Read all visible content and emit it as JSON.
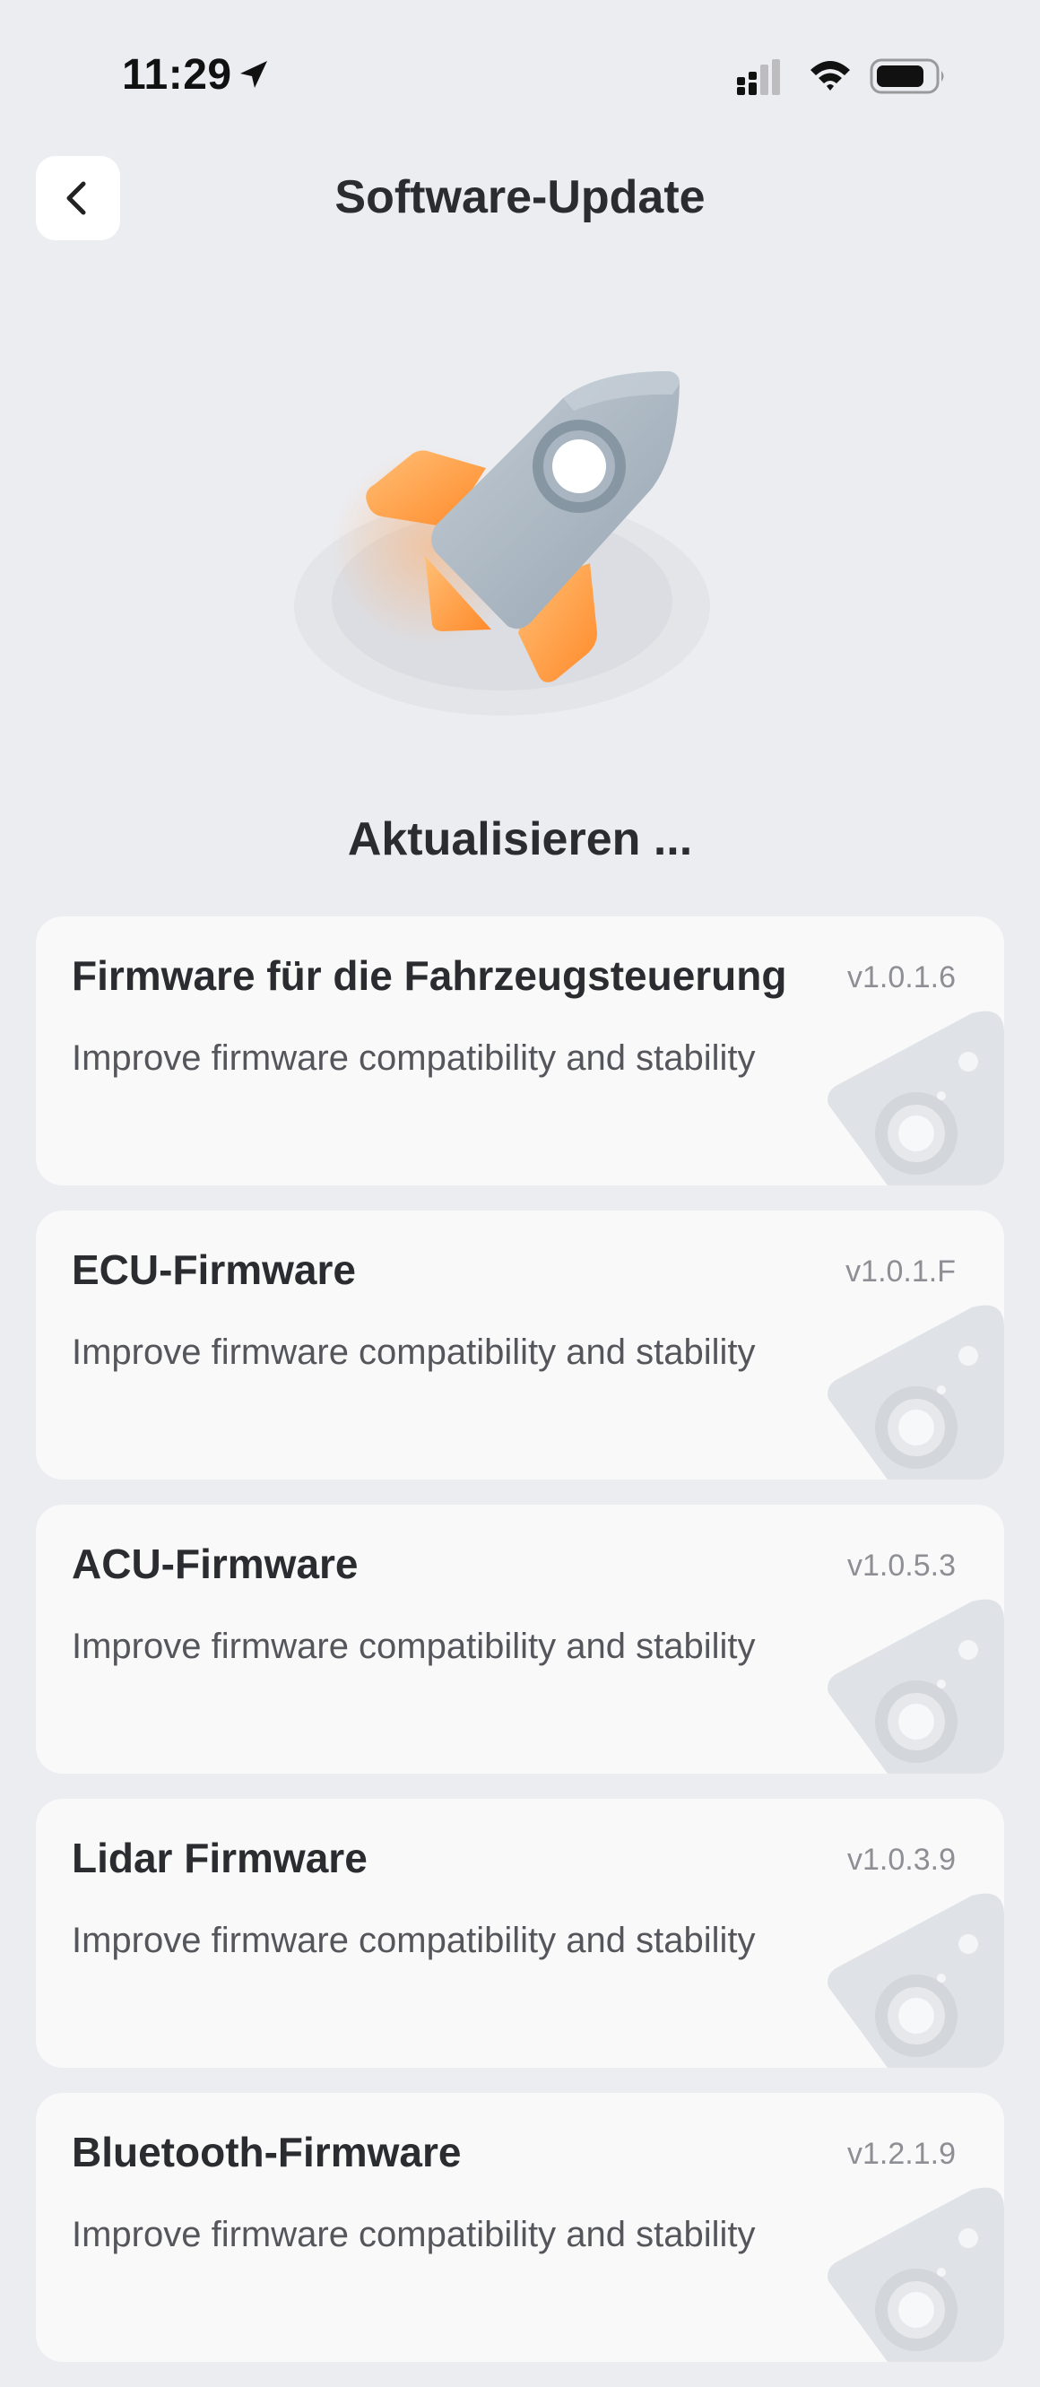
{
  "status_bar": {
    "time": "11:29"
  },
  "header": {
    "title": "Software-Update"
  },
  "hero": {
    "status_text": "Aktualisieren ..."
  },
  "firmware_items": [
    {
      "name": "Firmware für die Fahrzeugsteuerung",
      "version": "v1.0.1.6",
      "description": "Improve firmware compatibility and stability"
    },
    {
      "name": "ECU-Firmware",
      "version": "v1.0.1.F",
      "description": "Improve firmware compatibility and stability"
    },
    {
      "name": "ACU-Firmware",
      "version": "v1.0.5.3",
      "description": "Improve firmware compatibility and stability"
    },
    {
      "name": "Lidar Firmware",
      "version": "v1.0.3.9",
      "description": "Improve firmware compatibility and stability"
    },
    {
      "name": "Bluetooth-Firmware",
      "version": "v1.2.1.9",
      "description": "Improve firmware compatibility and stability"
    }
  ],
  "icons": {
    "status": [
      "location-arrow-icon",
      "cellular-signal-icon",
      "wifi-icon",
      "battery-icon"
    ],
    "header": "chevron-left-icon",
    "hero": "rocket-icon",
    "card": "device-sensor-icon"
  },
  "colors": {
    "background": "#ecedf1",
    "card": "#f9f9fa",
    "rocket_flame": "#ff9a3c",
    "rocket_body": "#a9b6c1",
    "version_text": "#8e8f94"
  }
}
